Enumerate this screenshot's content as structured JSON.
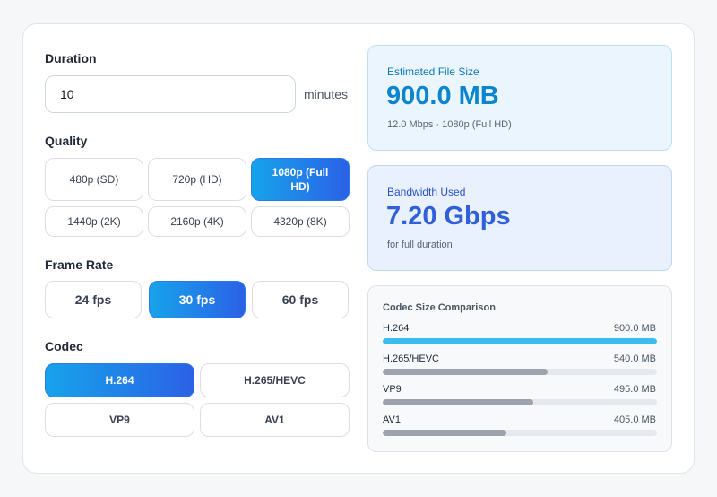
{
  "duration": {
    "label": "Duration",
    "value": "10",
    "unit": "minutes"
  },
  "quality": {
    "label": "Quality",
    "options": [
      "480p (SD)",
      "720p (HD)",
      "1080p (Full HD)",
      "1440p (2K)",
      "2160p (4K)",
      "4320p (8K)"
    ],
    "selected": "1080p (Full HD)"
  },
  "frame_rate": {
    "label": "Frame Rate",
    "options": [
      "24 fps",
      "30 fps",
      "60 fps"
    ],
    "selected": "30 fps"
  },
  "codec": {
    "label": "Codec",
    "options": [
      "H.264",
      "H.265/HEVC",
      "VP9",
      "AV1"
    ],
    "selected": "H.264"
  },
  "file_size": {
    "title": "Estimated File Size",
    "value": "900.0 MB",
    "details": "12.0 Mbps · 1080p (Full HD)"
  },
  "bandwidth": {
    "title": "Bandwidth Used",
    "value": "7.20 Gbps",
    "details": "for full duration"
  },
  "comparison": {
    "title": "Codec Size Comparison",
    "rows": [
      {
        "name": "H.264",
        "size": "900.0 MB",
        "fraction": 1.0,
        "color": "#3bbdf0"
      },
      {
        "name": "H.265/HEVC",
        "size": "540.0 MB",
        "fraction": 0.6,
        "color": "#9ca3ad"
      },
      {
        "name": "VP9",
        "size": "495.0 MB",
        "fraction": 0.55,
        "color": "#9ca3ad"
      },
      {
        "name": "AV1",
        "size": "405.0 MB",
        "fraction": 0.45,
        "color": "#9ca3ad"
      }
    ]
  },
  "colors": {
    "accent_start": "#17a3ea",
    "accent_end": "#2b61e6"
  }
}
